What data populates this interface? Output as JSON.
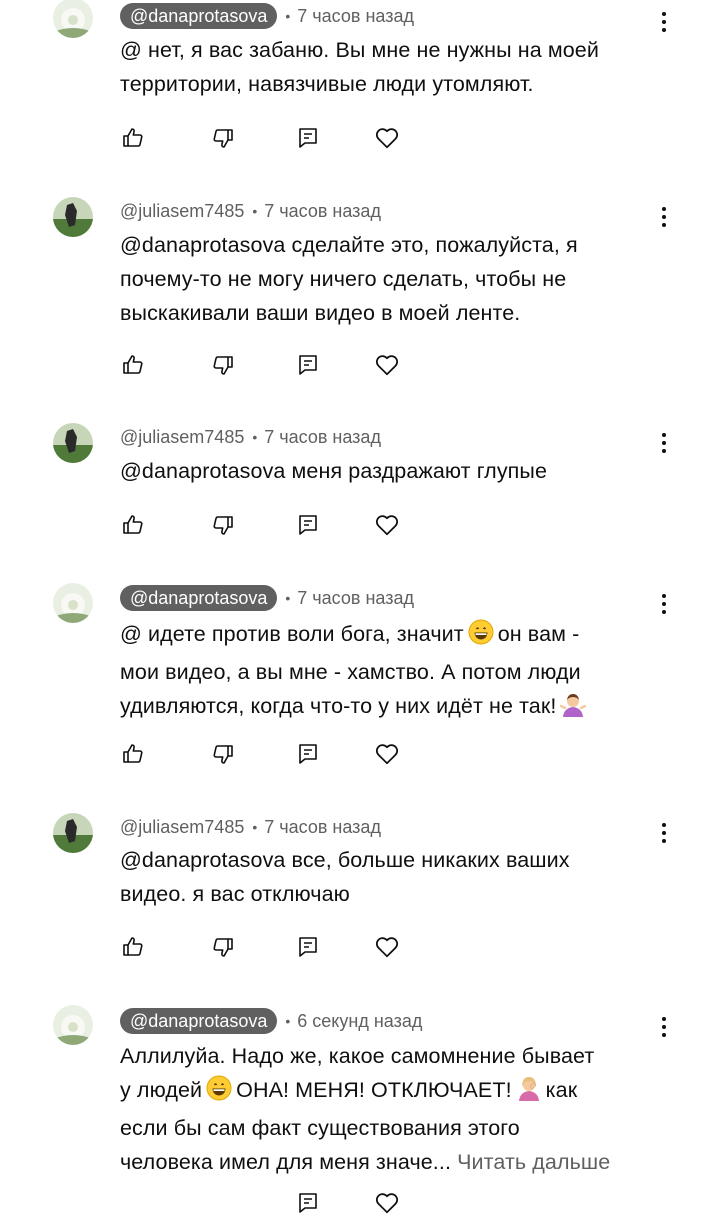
{
  "icons": {
    "like": "thumbs-up-icon",
    "dislike": "thumbs-down-icon",
    "reply": "reply-icon",
    "heart": "heart-icon",
    "more": "more-vertical-icon"
  },
  "colors": {
    "text": "#0f0f0f",
    "secondary": "#606060",
    "badge_bg": "#606060",
    "badge_text": "#ffffff"
  },
  "comments": [
    {
      "author": "@danaprotasova",
      "author_is_creator": true,
      "separator": "•",
      "time": "7 часов назад",
      "lines": [
        "@ нет, я вас забаню. Вы мне не нужны на моей",
        "территории, навязчивые люди утомляют."
      ]
    },
    {
      "author": "@juliasem7485",
      "author_is_creator": false,
      "separator": "•",
      "time": "7 часов назад",
      "lines": [
        "@danaprotasova сделайте это, пожалуйста, я",
        "почему-то не могу ничего сделать, чтобы не",
        "выскакивали ваши видео в моей ленте."
      ]
    },
    {
      "author": "@juliasem7485",
      "author_is_creator": false,
      "separator": "•",
      "time": "7 часов назад",
      "lines": [
        "@danaprotasova меня раздражают глупые"
      ]
    },
    {
      "author": "@danaprotasova",
      "author_is_creator": true,
      "separator": "•",
      "time": "7 часов назад",
      "lines": [
        "@ идете против воли бога, значит",
        "он вам -",
        "мои видео, а вы мне - хамство. А потом люди",
        "удивляются, когда что-то у них идёт не так!"
      ]
    },
    {
      "author": "@juliasem7485",
      "author_is_creator": false,
      "separator": "•",
      "time": "7 часов назад",
      "lines": [
        "@danaprotasova все, больше никаких ваших",
        "видео. я вас отключаю"
      ]
    },
    {
      "author": "@danaprotasova",
      "author_is_creator": true,
      "separator": "•",
      "time": "6 секунд назад",
      "lines": [
        "Аллилуйа. Надо же, какое самомнение бывает",
        "у людей",
        "ОНА! МЕНЯ! ОТКЛЮЧАЕТ!",
        "как",
        "если бы сам факт существования этого",
        "человека имел для меня значе..."
      ],
      "read_more": "Читать дальше"
    }
  ]
}
